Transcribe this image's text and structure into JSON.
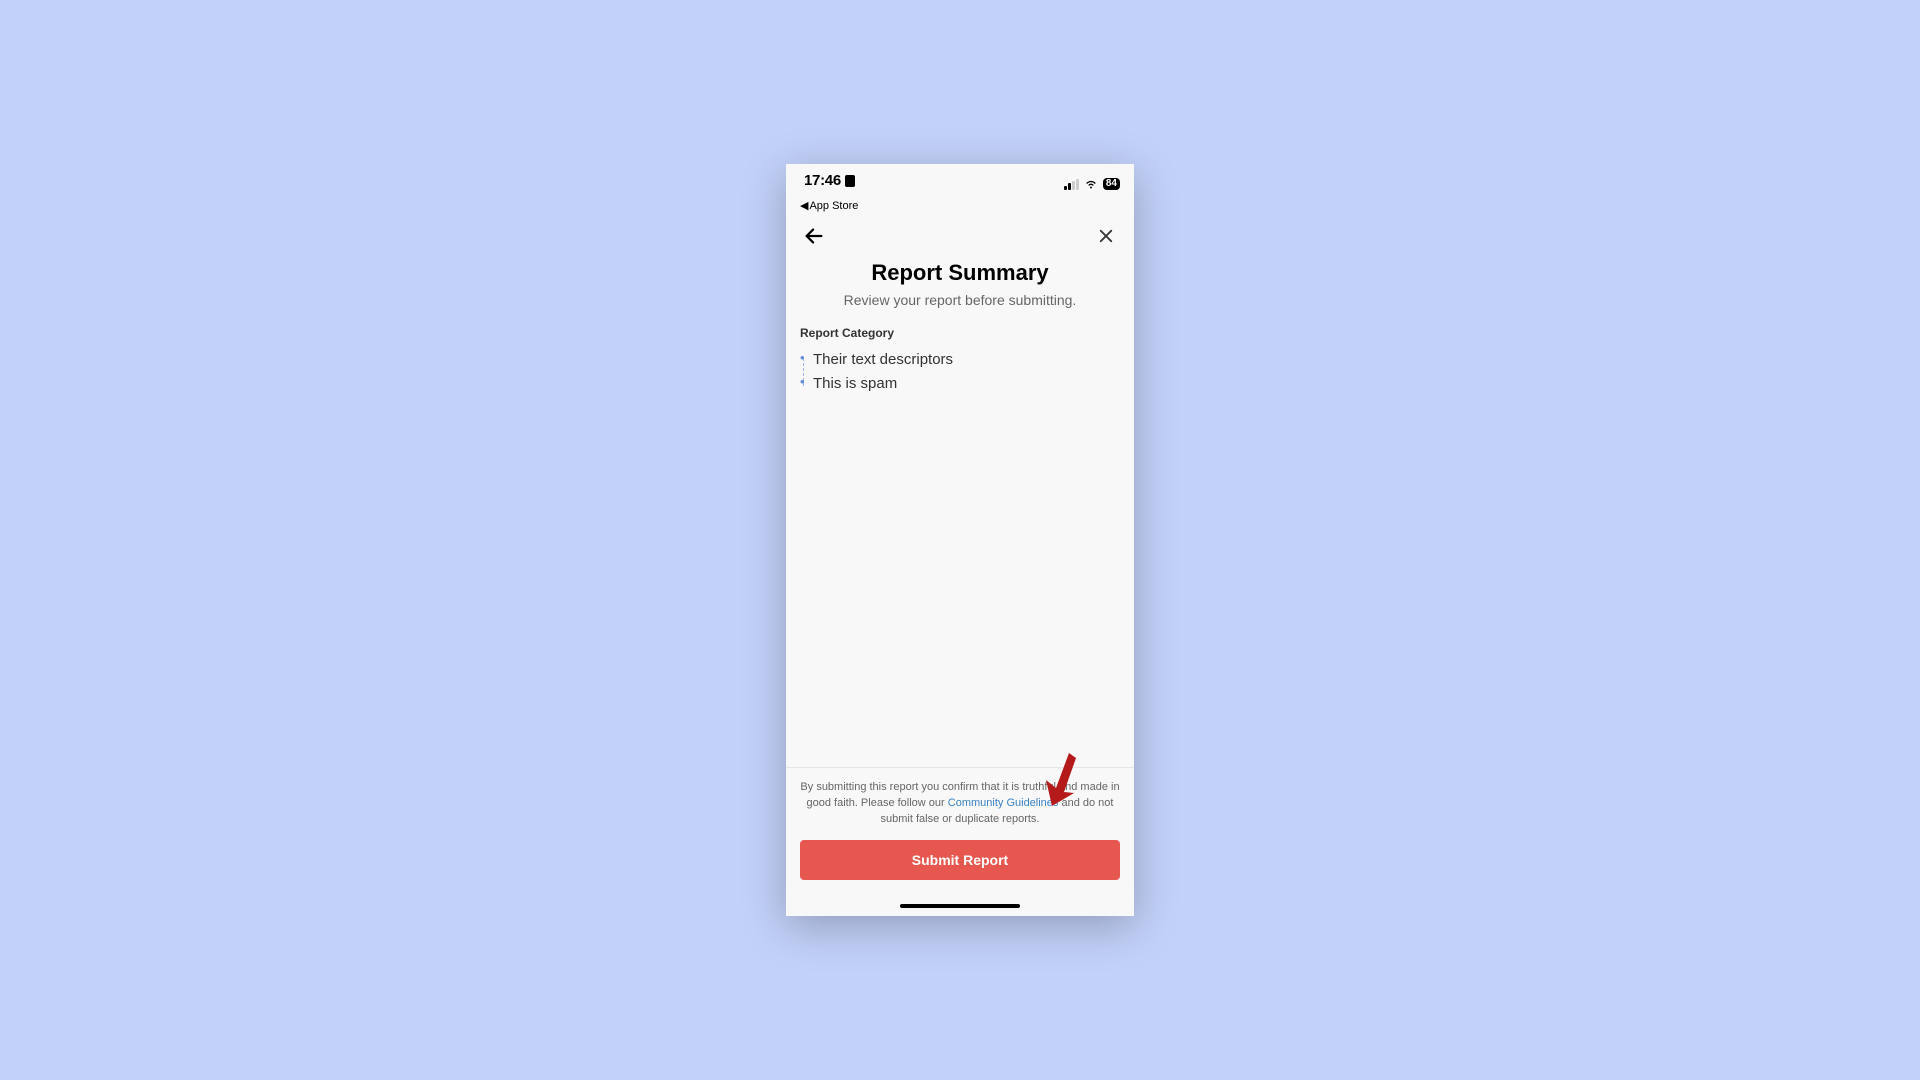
{
  "statusBar": {
    "time": "17:46",
    "appReturn": "App Store",
    "batteryPercent": "84"
  },
  "header": {
    "title": "Report Summary",
    "subtitle": "Review your report before submitting."
  },
  "section": {
    "label": "Report Category",
    "items": [
      "Their text descriptors",
      "This is spam"
    ]
  },
  "footer": {
    "disclaimer_pre": "By submitting this report you confirm that it is truthful and made in good faith. Please follow our ",
    "disclaimer_link": "Community Guidelines",
    "disclaimer_post": " and do not submit false or duplicate reports.",
    "submitLabel": "Submit Report"
  }
}
